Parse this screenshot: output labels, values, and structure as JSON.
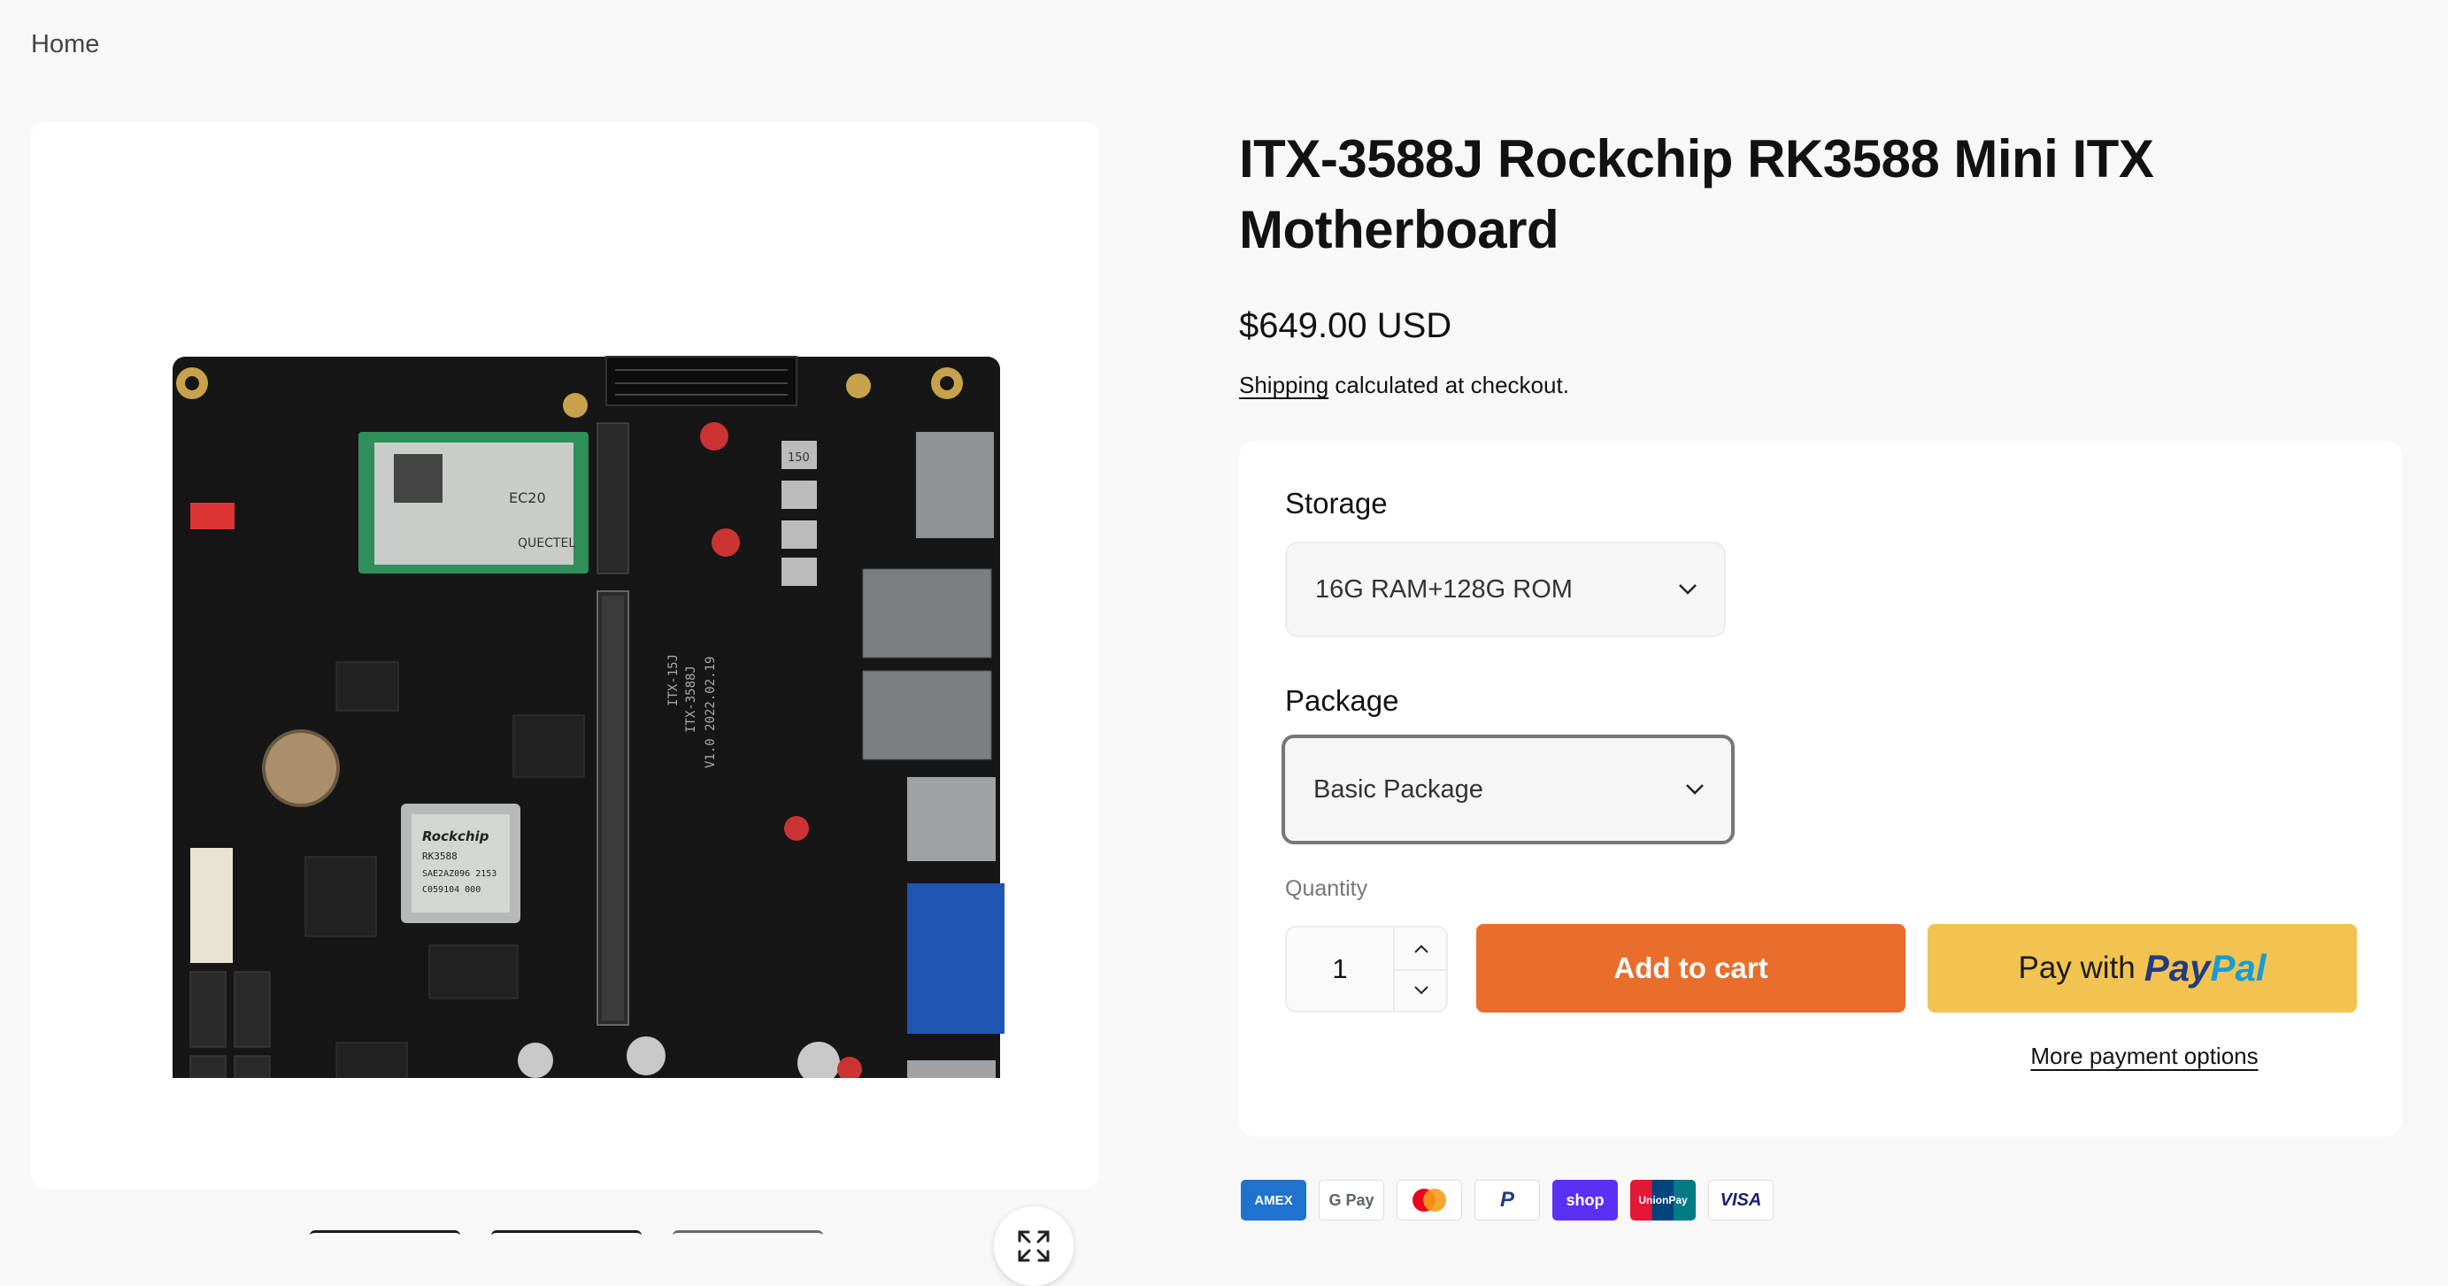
{
  "breadcrumb": {
    "home": "Home"
  },
  "product": {
    "title": "ITX-3588J Rockchip RK3588 Mini ITX Motherboard",
    "price": "$649.00 USD",
    "shipping_link": "Shipping",
    "shipping_suffix": " calculated at checkout."
  },
  "board_print": {
    "chip_brand": "Rockchip",
    "chip_model": "RK3588",
    "chip_line1": "SAE2AZ096 2153",
    "chip_line2": "C059104 000",
    "module_brand": "QUECTEL",
    "module_model": "EC20",
    "silk1": "ITX-15J",
    "silk2": "ITX-3588J",
    "silk3": "V1.0 2022.02.19",
    "inductor": "150"
  },
  "options": {
    "storage_label": "Storage",
    "storage_value": "16G RAM+128G ROM",
    "package_label": "Package",
    "package_value": "Basic Package"
  },
  "purchase": {
    "quantity_label": "Quantity",
    "quantity_value": "1",
    "add_to_cart": "Add to cart",
    "paypal_prefix": "Pay with",
    "paypal_brand_1": "Pay",
    "paypal_brand_2": "Pal",
    "more_payment": "More payment options"
  },
  "payment_icons": [
    {
      "label": "AMEX",
      "bg": "#1f72cd",
      "fg": "#ffffff"
    },
    {
      "label": "G Pay",
      "bg": "#ffffff",
      "fg": "#5f6368"
    },
    {
      "label": "MC",
      "bg": "#ffffff",
      "fg": "#eb001b"
    },
    {
      "label": "P",
      "bg": "#ffffff",
      "fg": "#253b80"
    },
    {
      "label": "shop",
      "bg": "#5a31f4",
      "fg": "#ffffff"
    },
    {
      "label": "UnionPay",
      "bg": "#e21836",
      "fg": "#ffffff"
    },
    {
      "label": "VISA",
      "bg": "#ffffff",
      "fg": "#1a1f71"
    }
  ],
  "colors": {
    "accent_cart": "#e96d2b",
    "paypal_yellow": "#f2c350",
    "board": "#1a1a1a"
  }
}
